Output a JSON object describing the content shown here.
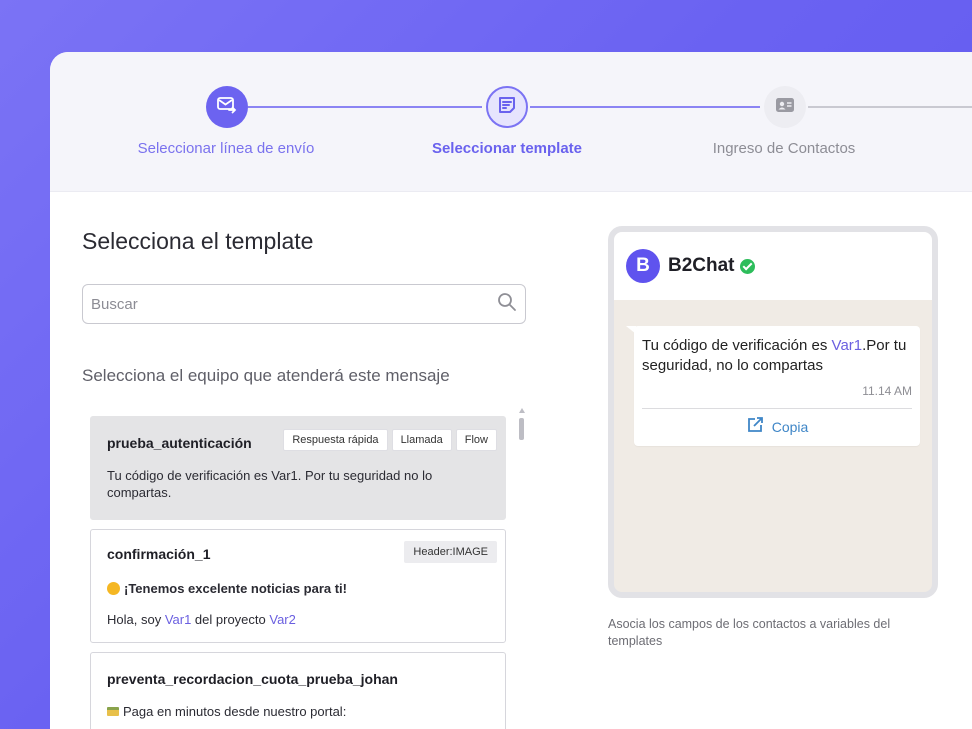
{
  "stepper": {
    "steps": [
      {
        "label": "Seleccionar línea de envío",
        "state": "done",
        "icon": "mail-send-icon"
      },
      {
        "label": "Seleccionar template",
        "state": "active",
        "icon": "template-icon"
      },
      {
        "label": "Ingreso de Contactos",
        "state": "pending",
        "icon": "contact-card-icon"
      }
    ]
  },
  "main": {
    "title": "Selecciona el template",
    "search_placeholder": "Buscar",
    "team_label": "Selecciona el equipo que atenderá este mensaje"
  },
  "templates": [
    {
      "name": "prueba_autenticación",
      "tags": [
        "Respuesta rápida",
        "Llamada",
        "Flow"
      ],
      "text": "Tu código de verificación es Var1. Por tu seguridad no lo compartas.",
      "selected": true
    },
    {
      "name": "confirmación_1",
      "tags": [
        "Header:IMAGE"
      ],
      "headline": "¡Tenemos excelente noticias para ti!",
      "text_pre": "Hola, soy ",
      "var1": "Var1",
      "text_mid": " del proyecto ",
      "var2": "Var2",
      "selected": false
    },
    {
      "name": "preventa_recordacion_cuota_prueba_johan",
      "text": "Paga en minutos desde nuestro portal:",
      "selected": false
    }
  ],
  "preview": {
    "brand": "B2Chat",
    "logo_letter": "B",
    "message_pre": "Tu código de verificación es ",
    "message_var": "Var1",
    "message_post": ".Por tu seguridad, no lo compartas",
    "time": "11.14 AM",
    "button_label": "Copia",
    "caption": "Asocia los campos de los contactos a variables del templates"
  },
  "colors": {
    "accent": "#6c63f0",
    "background_gradient": "#7b73f5",
    "verified": "#2dbd5b",
    "link": "#3f86c7"
  }
}
